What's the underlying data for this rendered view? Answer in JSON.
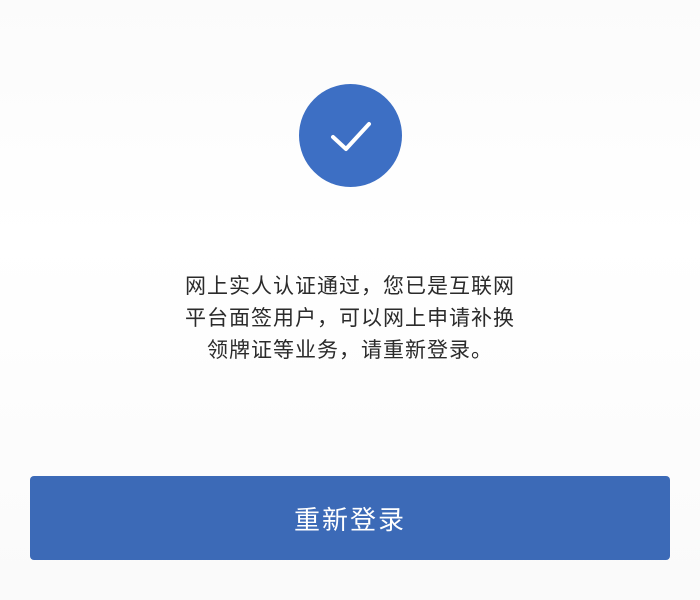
{
  "status": {
    "icon": "check-icon",
    "badge_color": "#3d6fc4"
  },
  "message": {
    "lines": [
      "网上实人认证通过，您已是互联网",
      "平台面签用户，可以网上申请补换",
      "领牌证等业务，请重新登录。"
    ]
  },
  "actions": {
    "relogin_label": "重新登录",
    "button_color": "#3c6ab7"
  }
}
